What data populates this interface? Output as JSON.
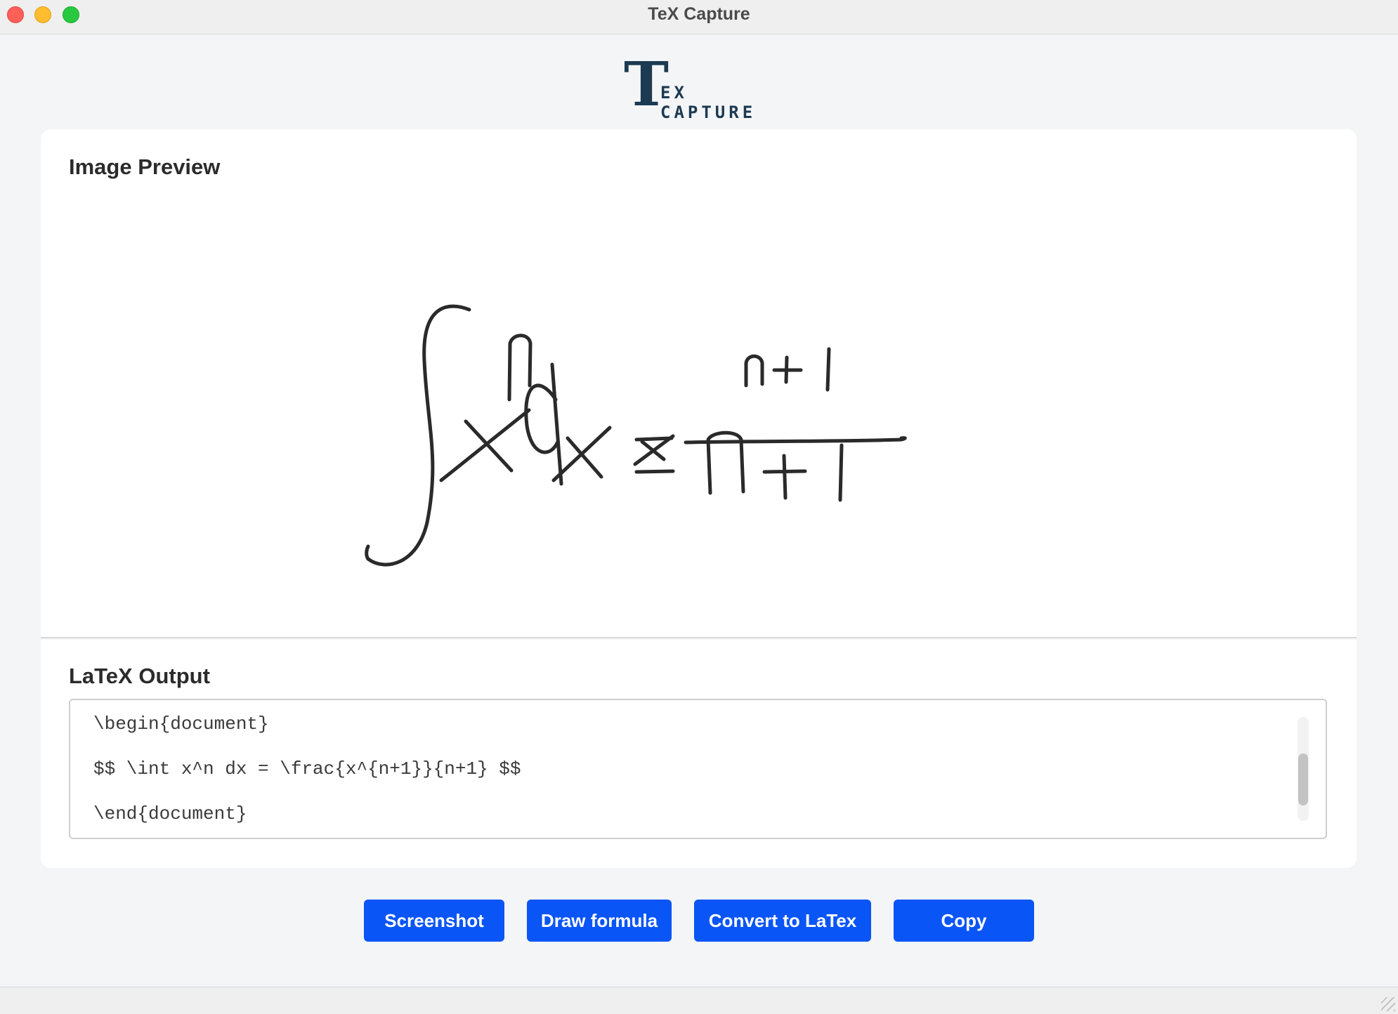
{
  "window": {
    "title": "TeX Capture"
  },
  "logo": {
    "initial": "T",
    "rest": "EX CAPTURE"
  },
  "preview": {
    "title": "Image Preview"
  },
  "output": {
    "title": "LaTeX Output",
    "lines": [
      "\\begin{document}",
      "$$ \\int x^n dx = \\frac{x^{n+1}}{n+1} $$",
      "\\end{document}"
    ]
  },
  "buttons": {
    "screenshot": "Screenshot",
    "draw": "Draw formula",
    "convert": "Convert to LaTex",
    "copy": "Copy"
  },
  "colors": {
    "accent": "#0a55f5",
    "logo": "#1c3a52",
    "ink": "#2b2b2b"
  }
}
